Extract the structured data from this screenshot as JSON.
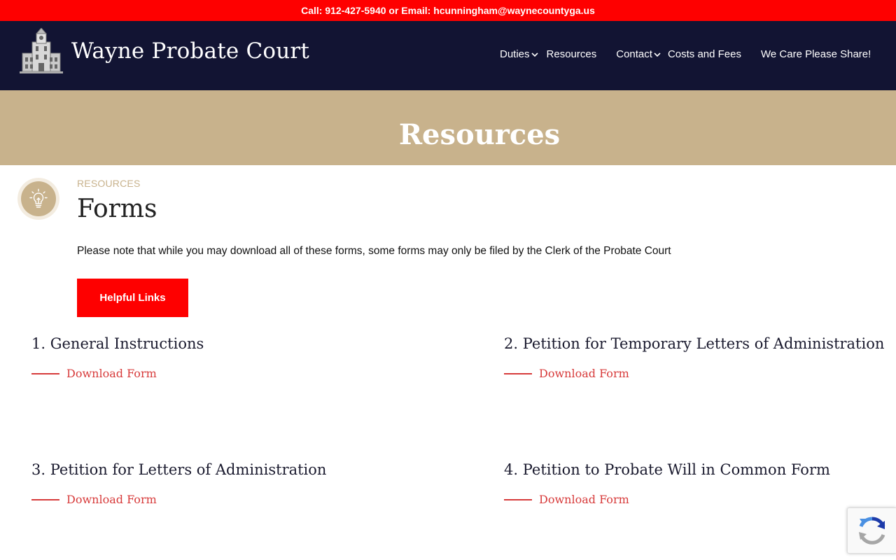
{
  "topbar": {
    "text": "Call: 912-427-5940 or Email: hcunningham@waynecountyga.us"
  },
  "header": {
    "site_title": "Wayne Probate Court",
    "logo_icon": "courthouse-logo"
  },
  "nav": {
    "items": [
      {
        "label": "Duties",
        "dropdown": true
      },
      {
        "label": "Resources",
        "dropdown": false
      },
      {
        "label": "Contact",
        "dropdown": true
      },
      {
        "label": "Costs and Fees",
        "dropdown": false
      },
      {
        "label": "We Care Please Share!",
        "dropdown": false
      }
    ]
  },
  "hero": {
    "title": "Resources"
  },
  "section": {
    "eyebrow": "RESOURCES",
    "title": "Forms",
    "note": "Please note that while you may download all of these forms, some forms may only be filed by the Clerk of the Probate Court",
    "icon": "lightbulb-icon"
  },
  "helpful_button": {
    "label": "Helpful Links"
  },
  "forms": [
    {
      "title": "1. General Instructions",
      "link_label": "Download Form"
    },
    {
      "title": "2. Petition for Temporary Letters of Administration",
      "link_label": "Download Form"
    },
    {
      "title": "3. Petition for Letters of Administration",
      "link_label": "Download Form"
    },
    {
      "title": "4. Petition to Probate Will in Common Form",
      "link_label": "Download Form"
    }
  ],
  "colors": {
    "topbar_red": "#fe0000",
    "header_navy": "#121433",
    "hero_tan": "#c8b28c",
    "link_red": "#d73a3a"
  }
}
